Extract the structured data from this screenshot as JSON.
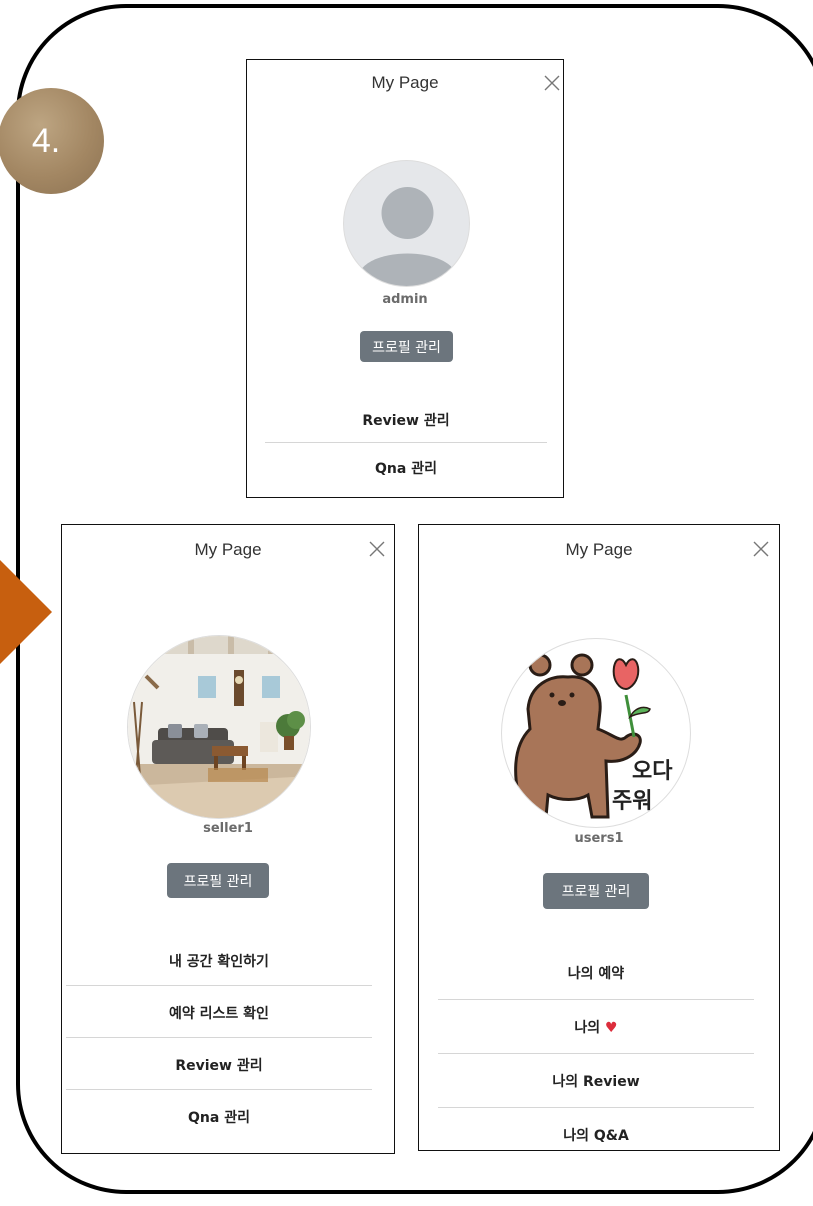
{
  "step_badge": "4.",
  "panels": {
    "admin": {
      "title": "My Page",
      "username": "admin",
      "profile_button": "프로필 관리",
      "menu": [
        "Review 관리",
        "Qna 관리"
      ]
    },
    "seller": {
      "title": "My Page",
      "username": "seller1",
      "profile_button": "프로필 관리",
      "menu": [
        "내 공간 확인하기",
        "예약 리스트 확인",
        "Review 관리",
        "Qna 관리"
      ]
    },
    "user": {
      "title": "My Page",
      "username": "users1",
      "profile_button": "프로필 관리",
      "menu": [
        "나의 예약",
        "나의",
        "나의 Review",
        "나의 Q&A"
      ],
      "heart_icon": "heart-icon",
      "avatar_caption_line1": "오다",
      "avatar_caption_line2": "주워"
    }
  },
  "colors": {
    "badge": "#a38763",
    "arrow": "#c75f0f",
    "button": "#6c757d",
    "heart": "#dc2d3c"
  }
}
